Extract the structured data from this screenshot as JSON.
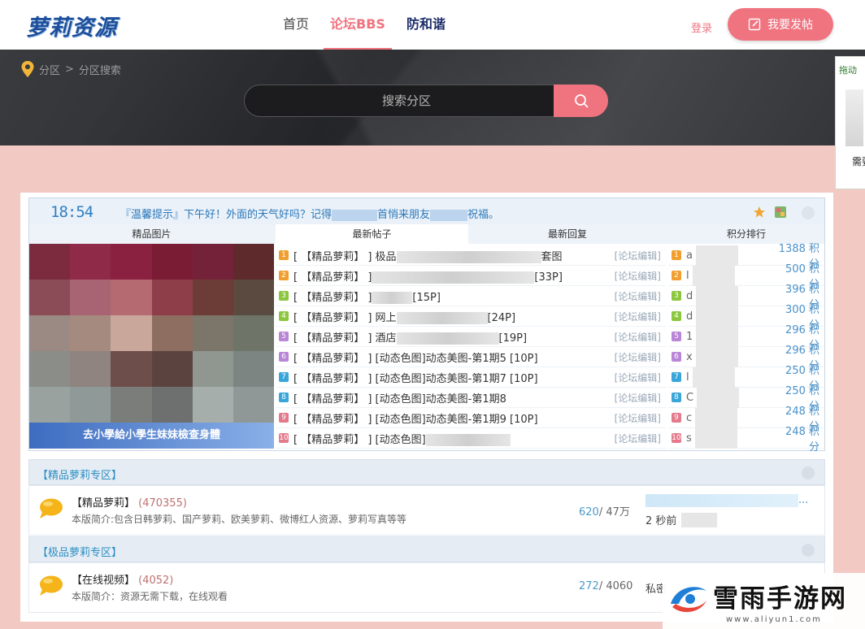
{
  "header": {
    "logo": "萝莉资源",
    "nav": [
      "首页",
      "论坛BBS",
      "防和谐"
    ],
    "login": "登录",
    "post_button": "我要发帖"
  },
  "breadcrumb": {
    "home": "分区",
    "separator": ">",
    "current": "分区搜索"
  },
  "search": {
    "placeholder": "搜索分区"
  },
  "side_panel": {
    "tag": "拖动",
    "text": "需要"
  },
  "tip": {
    "clock": "18:54",
    "message_a": "『温馨提示』下午好！外面的天气好吗？记得",
    "message_b": "首悄来朋友",
    "message_c": "祝福。"
  },
  "columns": [
    "精品图片",
    "最新帖子",
    "最新回复",
    "积分排行"
  ],
  "image_caption": "去小學給小學生妹妹檢查身體",
  "posts": [
    {
      "rank": "1",
      "prefix": "[ 【精品萝莉】 ] 极品",
      "suffix": "套图",
      "forum": "[论坛编辑]"
    },
    {
      "rank": "2",
      "prefix": "[ 【精品萝莉】 ]",
      "suffix": "[33P]",
      "forum": "[论坛编辑]"
    },
    {
      "rank": "3",
      "prefix": "[ 【精品萝莉】 ]",
      "suffix": "[15P]",
      "forum": "[论坛编辑]"
    },
    {
      "rank": "4",
      "prefix": "[ 【精品萝莉】 ] 网上",
      "suffix": "[24P]",
      "forum": "[论坛编辑]"
    },
    {
      "rank": "5",
      "prefix": "[ 【精品萝莉】 ] 酒店",
      "suffix": "[19P]",
      "forum": "[论坛编辑]"
    },
    {
      "rank": "6",
      "prefix": "[ 【精品萝莉】 ] [动态色图]动态美图-第1期5 [10P]",
      "suffix": "",
      "forum": "[论坛编辑]"
    },
    {
      "rank": "7",
      "prefix": "[ 【精品萝莉】 ] [动态色图]动态美图-第1期7 [10P]",
      "suffix": "",
      "forum": "[论坛编辑]"
    },
    {
      "rank": "8",
      "prefix": "[ 【精品萝莉】 ] [动态色图]动态美图-第1期8",
      "suffix": "",
      "forum": "[论坛编辑]"
    },
    {
      "rank": "9",
      "prefix": "[ 【精品萝莉】 ] [动态色图]动态美图-第1期9 [10P]",
      "suffix": "",
      "forum": "[论坛编辑]"
    },
    {
      "rank": "10",
      "prefix": "[ 【精品萝莉】 ] [动态色图]",
      "suffix": "",
      "forum": "[论坛编辑]"
    }
  ],
  "ranking": [
    {
      "rank": "1",
      "initial": "a",
      "score": "1388 积分"
    },
    {
      "rank": "2",
      "initial": "l",
      "score": "500 积分"
    },
    {
      "rank": "3",
      "initial": "d",
      "score": "396 积分"
    },
    {
      "rank": "4",
      "initial": "d",
      "score": "300 积分"
    },
    {
      "rank": "5",
      "initial": "1",
      "score": "296 积分"
    },
    {
      "rank": "6",
      "initial": "x",
      "score": "296 积分"
    },
    {
      "rank": "7",
      "initial": "l",
      "score": "250 积分"
    },
    {
      "rank": "8",
      "initial": "C",
      "score": "250 积分"
    },
    {
      "rank": "9",
      "initial": "c",
      "score": "248 积分"
    },
    {
      "rank": "10",
      "initial": "s",
      "score": "248 积分"
    }
  ],
  "zones": [
    {
      "title": "【精品萝莉专区】",
      "forum": {
        "name": "【精品萝莉】",
        "count": "(470355)",
        "desc": "本版简介:包含日韩萝莉、国产萝莉、欧美萝莉、微博红人资源、萝莉写真等等",
        "stats_a": "620",
        "stats_b": "/ 47万",
        "last_dots": "...",
        "last_time": "2 秒前"
      }
    },
    {
      "title": "【极品萝莉专区】",
      "forum": {
        "name": "【在线视频】",
        "count": "(4052)",
        "desc": "本版简介：资源无需下载，在线观看",
        "stats_a": "272",
        "stats_b": "/ 4060",
        "last_private": "私密"
      }
    }
  ],
  "watermark": {
    "title": "雪雨手游网",
    "url": "www.aliyun1.com"
  },
  "colors": {
    "accent": "#ef7480",
    "link_blue": "#2b8fc4",
    "banner": "#333438",
    "page_bg": "#f3c9c4"
  }
}
